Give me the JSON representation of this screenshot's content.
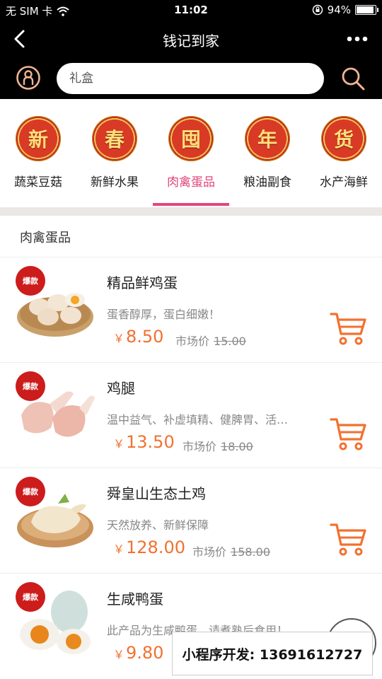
{
  "status_bar": {
    "carrier": "无 SIM 卡",
    "time": "11:02",
    "battery_text": "94%",
    "battery_level": 0.94
  },
  "navbar": {
    "title": "钱记到家"
  },
  "search": {
    "placeholder": "礼盒"
  },
  "categories": [
    {
      "badge": "新",
      "label": "蔬菜豆菇",
      "active": false
    },
    {
      "badge": "春",
      "label": "新鲜水果",
      "active": false
    },
    {
      "badge": "囤",
      "label": "肉禽蛋品",
      "active": true
    },
    {
      "badge": "年",
      "label": "粮油副食",
      "active": false
    },
    {
      "badge": "货",
      "label": "水产海鲜",
      "active": false
    }
  ],
  "section": {
    "title": "肉禽蛋品"
  },
  "products": [
    {
      "hot_label": "爆款",
      "name": "精品鲜鸡蛋",
      "desc": "蛋香醇厚，蛋白细嫩！",
      "price_symbol": "￥",
      "price": "8.50",
      "market_label": "市场价",
      "market_price": "15.00",
      "image": "eggs-basket"
    },
    {
      "hot_label": "爆款",
      "name": "鸡腿",
      "desc": "温中益气、补虚填精、健脾胃、活…",
      "price_symbol": "￥",
      "price": "13.50",
      "market_label": "市场价",
      "market_price": "18.00",
      "image": "chicken-legs"
    },
    {
      "hot_label": "爆款",
      "name": "舜皇山生态土鸡",
      "desc": "天然放养、新鲜保障",
      "price_symbol": "￥",
      "price": "128.00",
      "market_label": "市场价",
      "market_price": "158.00",
      "image": "whole-chicken"
    },
    {
      "hot_label": "爆款",
      "name": "生咸鸭蛋",
      "desc": "此产品为生咸鸭蛋，请煮熟后食用！",
      "price_symbol": "￥",
      "price": "9.80",
      "market_label": "",
      "market_price": "",
      "image": "salted-duck-eggs"
    }
  ],
  "watermark": {
    "text": "小程序开发: 13691612727"
  },
  "colors": {
    "accent": "#e2477a",
    "price": "#f2712f",
    "cart": "#f2712f",
    "header_bg": "#000000"
  }
}
